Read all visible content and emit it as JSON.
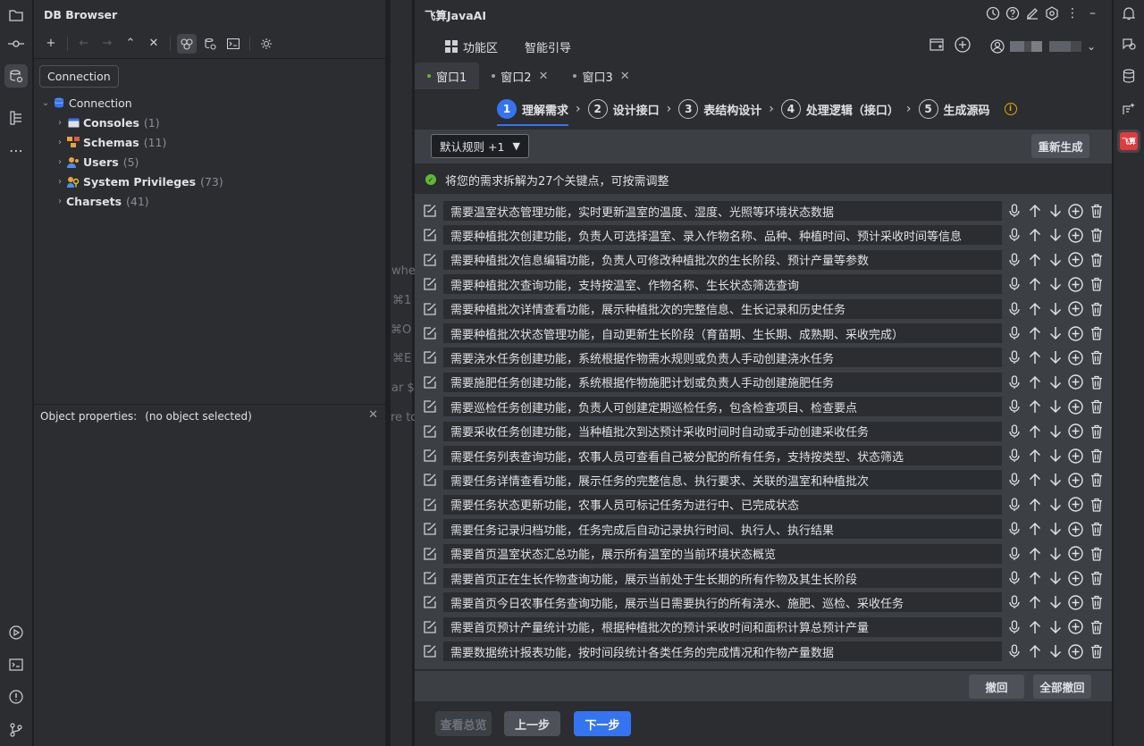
{
  "db": {
    "title": "DB Browser",
    "tooltip": "Connection",
    "root": "Connection",
    "items": [
      {
        "label": "Consoles",
        "count": "(1)"
      },
      {
        "label": "Schemas",
        "count": "(11)"
      },
      {
        "label": "Users",
        "count": "(5)"
      },
      {
        "label": "System Privileges",
        "count": "(73)"
      },
      {
        "label": "Charsets",
        "count": "(41)"
      }
    ],
    "obj_props_label": "Object properties:",
    "obj_props_value": "(no object selected)"
  },
  "ghost": {
    "l0": "whe",
    "l1": "⌘1",
    "l2": "⌘O",
    "l3": "⌘E",
    "l4": "ar $",
    "l5": "re to"
  },
  "main": {
    "title": "飞算JavaAI",
    "nav": {
      "features": "功能区",
      "guide": "智能引导"
    },
    "tabs": [
      {
        "label": "窗口1"
      },
      {
        "label": "窗口2"
      },
      {
        "label": "窗口3"
      }
    ],
    "steps": [
      {
        "num": "1",
        "label": "理解需求"
      },
      {
        "num": "2",
        "label": "设计接口"
      },
      {
        "num": "3",
        "label": "表结构设计"
      },
      {
        "num": "4",
        "label": "处理逻辑（接口）"
      },
      {
        "num": "5",
        "label": "生成源码"
      }
    ],
    "rule_select": "默认规则 +1",
    "regen": "重新生成",
    "notice": "将您的需求拆解为27个关键点，可按需调整",
    "requirements": [
      "需要温室状态管理功能，实时更新温室的温度、湿度、光照等环境状态数据",
      "需要种植批次创建功能，负责人可选择温室、录入作物名称、品种、种植时间、预计采收时间等信息",
      "需要种植批次信息编辑功能，负责人可修改种植批次的生长阶段、预计产量等参数",
      "需要种植批次查询功能，支持按温室、作物名称、生长状态筛选查询",
      "需要种植批次详情查看功能，展示种植批次的完整信息、生长记录和历史任务",
      "需要种植批次状态管理功能，自动更新生长阶段（育苗期、生长期、成熟期、采收完成）",
      "需要浇水任务创建功能，系统根据作物需水规则或负责人手动创建浇水任务",
      "需要施肥任务创建功能，系统根据作物施肥计划或负责人手动创建施肥任务",
      "需要巡检任务创建功能，负责人可创建定期巡检任务，包含检查项目、检查要点",
      "需要采收任务创建功能，当种植批次到达预计采收时间时自动或手动创建采收任务",
      "需要任务列表查询功能，农事人员可查看自己被分配的所有任务，支持按类型、状态筛选",
      "需要任务详情查看功能，展示任务的完整信息、执行要求、关联的温室和种植批次",
      "需要任务状态更新功能，农事人员可标记任务为进行中、已完成状态",
      "需要任务记录归档功能，任务完成后自动记录执行时间、执行人、执行结果",
      "需要首页温室状态汇总功能，展示所有温室的当前环境状态概览",
      "需要首页正在生长作物查询功能，展示当前处于生长期的所有作物及其生长阶段",
      "需要首页今日农事任务查询功能，展示当日需要执行的所有浇水、施肥、巡检、采收任务",
      "需要首页预计产量统计功能，根据种植批次的预计采收时间和面积计算总预计产量",
      "需要数据统计报表功能，按时间段统计各类任务的完成情况和作物产量数据"
    ],
    "undo": "撤回",
    "undo_all": "全部撤回",
    "overview": "查看总览",
    "prev": "上一步",
    "next": "下一步"
  },
  "right_rail": {
    "plugin_logo": "飞算"
  }
}
